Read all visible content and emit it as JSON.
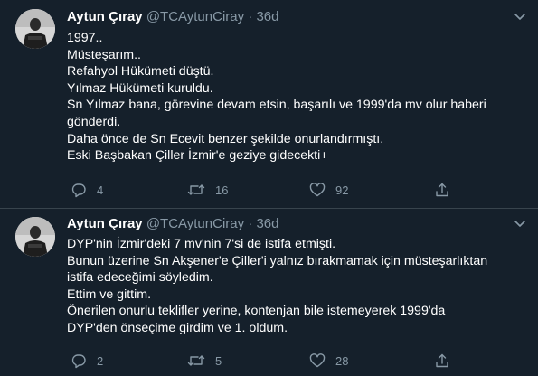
{
  "tweets": [
    {
      "author": "Aytun Çıray",
      "handle": "@TCAytunCiray",
      "separator": "·",
      "age": "36d",
      "lines": [
        "1997..",
        "Müsteşarım..",
        "Refahyol Hükümeti düştü.",
        "Yılmaz Hükümeti kuruldu.",
        "Sn Yılmaz bana, görevine devam etsin, başarılı ve 1999'da mv olur haberi",
        "gönderdi.",
        "Daha önce de Sn Ecevit benzer şekilde onurlandırmıştı.",
        "Eski Başbakan Çiller İzmir'e geziye gidecekti+"
      ],
      "replies": "4",
      "retweets": "16",
      "likes": "92"
    },
    {
      "author": "Aytun Çıray",
      "handle": "@TCAytunCiray",
      "separator": "·",
      "age": "36d",
      "lines": [
        "DYP'nin İzmir'deki 7 mv'nin 7'si de istifa etmişti.",
        "Bunun üzerine Sn Akşener'e Çiller'i yalnız bırakmamak için müsteşarlıktan",
        "istifa edeceğimi söyledim.",
        "Ettim ve gittim.",
        "Önerilen onurlu teklifler yerine, kontenjan bile istemeyerek 1999'da",
        "DYP'den önseçime girdim ve 1. oldum."
      ],
      "replies": "2",
      "retweets": "5",
      "likes": "28"
    }
  ],
  "icons": {
    "more": "chevron-down-icon",
    "reply": "reply-icon",
    "retweet": "retweet-icon",
    "like": "heart-icon",
    "share": "share-icon"
  },
  "colors": {
    "background": "#15202b",
    "divider": "#38444d",
    "secondary_text": "#8899a6",
    "primary_text": "#ffffff"
  }
}
